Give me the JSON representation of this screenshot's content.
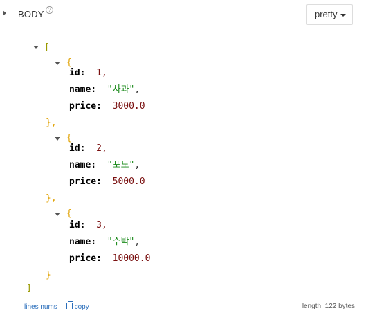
{
  "header": {
    "body_label": "BODY",
    "help_glyph": "?",
    "format_label": "pretty"
  },
  "json": {
    "open_array": "[",
    "close_array": "]",
    "open_obj": "{",
    "close_obj": "}",
    "close_obj_comma": "},",
    "items": [
      {
        "id_key": "id:",
        "id_val": "1,",
        "name_key": "name:",
        "name_val": "\"사과\"",
        "name_comma": ",",
        "price_key": "price:",
        "price_val": "3000.0"
      },
      {
        "id_key": "id:",
        "id_val": "2,",
        "name_key": "name:",
        "name_val": "\"포도\"",
        "name_comma": ",",
        "price_key": "price:",
        "price_val": "5000.0"
      },
      {
        "id_key": "id:",
        "id_val": "3,",
        "name_key": "name:",
        "name_val": "\"수박\"",
        "name_comma": ",",
        "price_key": "price:",
        "price_val": "10000.0"
      }
    ]
  },
  "footer": {
    "lines_nums": "lines nums",
    "copy": "copy",
    "length": "length: 122 bytes"
  }
}
